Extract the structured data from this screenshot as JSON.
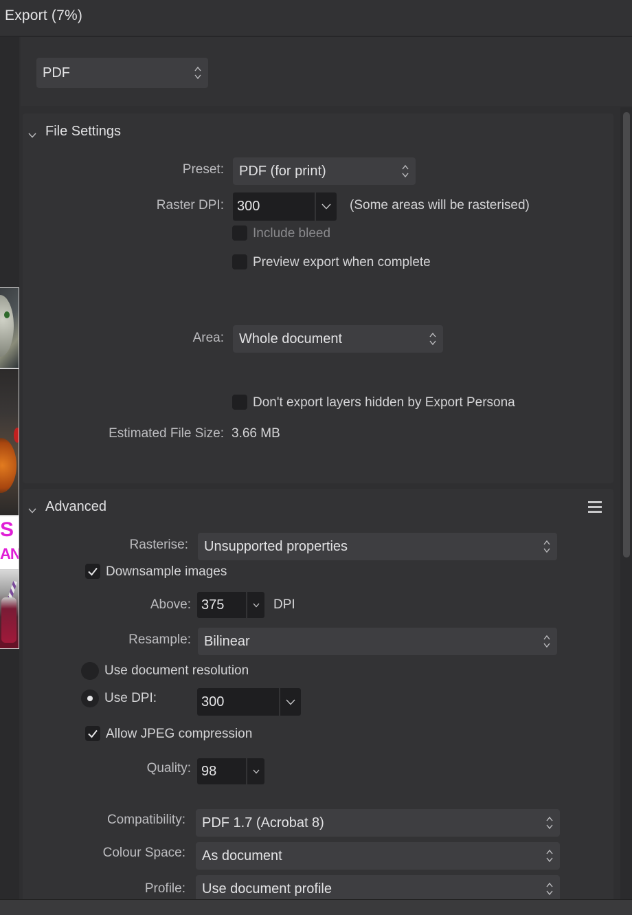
{
  "window": {
    "title": "Export (7%)"
  },
  "format_select": {
    "value": "PDF"
  },
  "file_settings": {
    "title": "File Settings",
    "preset_label": "Preset:",
    "preset_value": "PDF (for print)",
    "raster_dpi_label": "Raster DPI:",
    "raster_dpi_value": "300",
    "raster_note": "(Some areas will be rasterised)",
    "include_bleed_label": "Include bleed",
    "preview_export_label": "Preview export when complete",
    "area_label": "Area:",
    "area_value": "Whole document",
    "dont_export_hidden_label": "Don't export layers hidden by Export Persona",
    "estimated_size_label": "Estimated File Size:",
    "estimated_size_value": "3.66 MB"
  },
  "advanced": {
    "title": "Advanced",
    "rasterise_label": "Rasterise:",
    "rasterise_value": "Unsupported properties",
    "downsample_label": "Downsample images",
    "downsample_checked": true,
    "above_label": "Above:",
    "above_value": "375",
    "above_unit": "DPI",
    "resample_label": "Resample:",
    "resample_value": "Bilinear",
    "use_doc_resolution_label": "Use document resolution",
    "use_dpi_label": "Use DPI:",
    "use_dpi_value": "300",
    "use_dpi_selected": true,
    "allow_jpeg_label": "Allow JPEG compression",
    "allow_jpeg_checked": true,
    "quality_label": "Quality:",
    "quality_value": "98",
    "compatibility_label": "Compatibility:",
    "compatibility_value": "PDF 1.7 (Acrobat 8)",
    "colour_space_label": "Colour Space:",
    "colour_space_value": "As document",
    "profile_label": "Profile:",
    "profile_value": "Use document profile"
  },
  "thumbnails": {
    "strip_text_1": "S",
    "strip_text_2": "AN"
  },
  "icons": {
    "select_arrows": "updown-chevron-icon",
    "dropdown": "chevron-down-icon",
    "check": "checkmark-icon",
    "panel_menu": "hamburger-menu-icon",
    "collapse": "disclosure-chevron-icon"
  },
  "colors": {
    "background": "#2f2f31",
    "panel": "#333335",
    "field": "#1e1e20",
    "select": "#3e3e41",
    "text": "#d7d7d9"
  }
}
